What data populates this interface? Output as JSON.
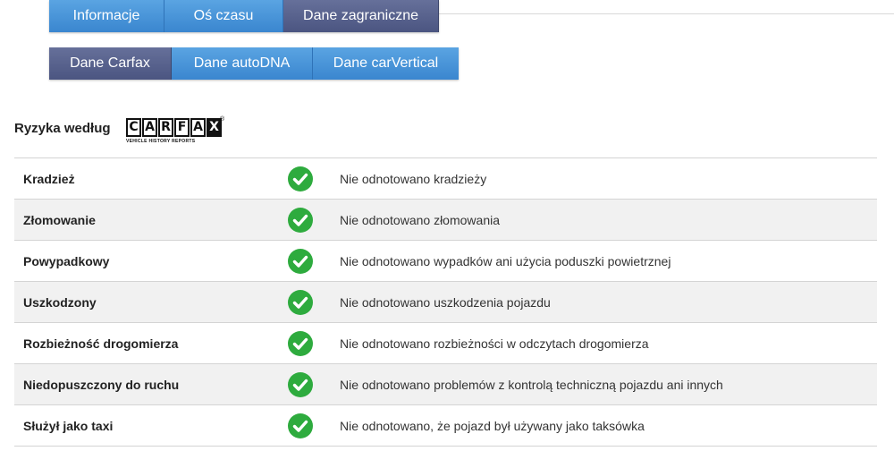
{
  "tabs_main": [
    {
      "label": "Informacje",
      "active": false
    },
    {
      "label": "Oś czasu",
      "active": false
    },
    {
      "label": "Dane zagraniczne",
      "active": true
    }
  ],
  "tabs_sub": [
    {
      "label": "Dane Carfax",
      "active": true
    },
    {
      "label": "Dane autoDNA",
      "active": false
    },
    {
      "label": "Dane carVertical",
      "active": false
    }
  ],
  "risk": {
    "title": "Ryzyka według",
    "logo": {
      "letters": [
        "C",
        "A",
        "R",
        "F",
        "A",
        "X"
      ],
      "subtitle": "VEHICLE HISTORY REPORTS",
      "registered": "®"
    },
    "rows": [
      {
        "label": "Kradzież",
        "status_icon": "check-circle-icon",
        "description": "Nie odnotowano kradzieży"
      },
      {
        "label": "Złomowanie",
        "status_icon": "check-circle-icon",
        "description": "Nie odnotowano złomowania"
      },
      {
        "label": "Powypadkowy",
        "status_icon": "check-circle-icon",
        "description": "Nie odnotowano wypadków ani użycia poduszki powietrznej"
      },
      {
        "label": "Uszkodzony",
        "status_icon": "check-circle-icon",
        "description": "Nie odnotowano uszkodzenia pojazdu"
      },
      {
        "label": "Rozbieżność drogomierza",
        "status_icon": "check-circle-icon",
        "description": "Nie odnotowano rozbieżności w odczytach drogomierza"
      },
      {
        "label": "Niedopuszczony do ruchu",
        "status_icon": "check-circle-icon",
        "description": "Nie odnotowano problemów z kontrolą techniczną pojazdu ani innych"
      },
      {
        "label": "Służył jako taxi",
        "status_icon": "check-circle-icon",
        "description": "Nie odnotowano, że pojazd był używany jako taksówka"
      }
    ]
  },
  "colors": {
    "tab_blue": "#3a86cf",
    "tab_active": "#4b5581",
    "check_green": "#2eab3e",
    "row_alt": "#f1f1f1"
  }
}
